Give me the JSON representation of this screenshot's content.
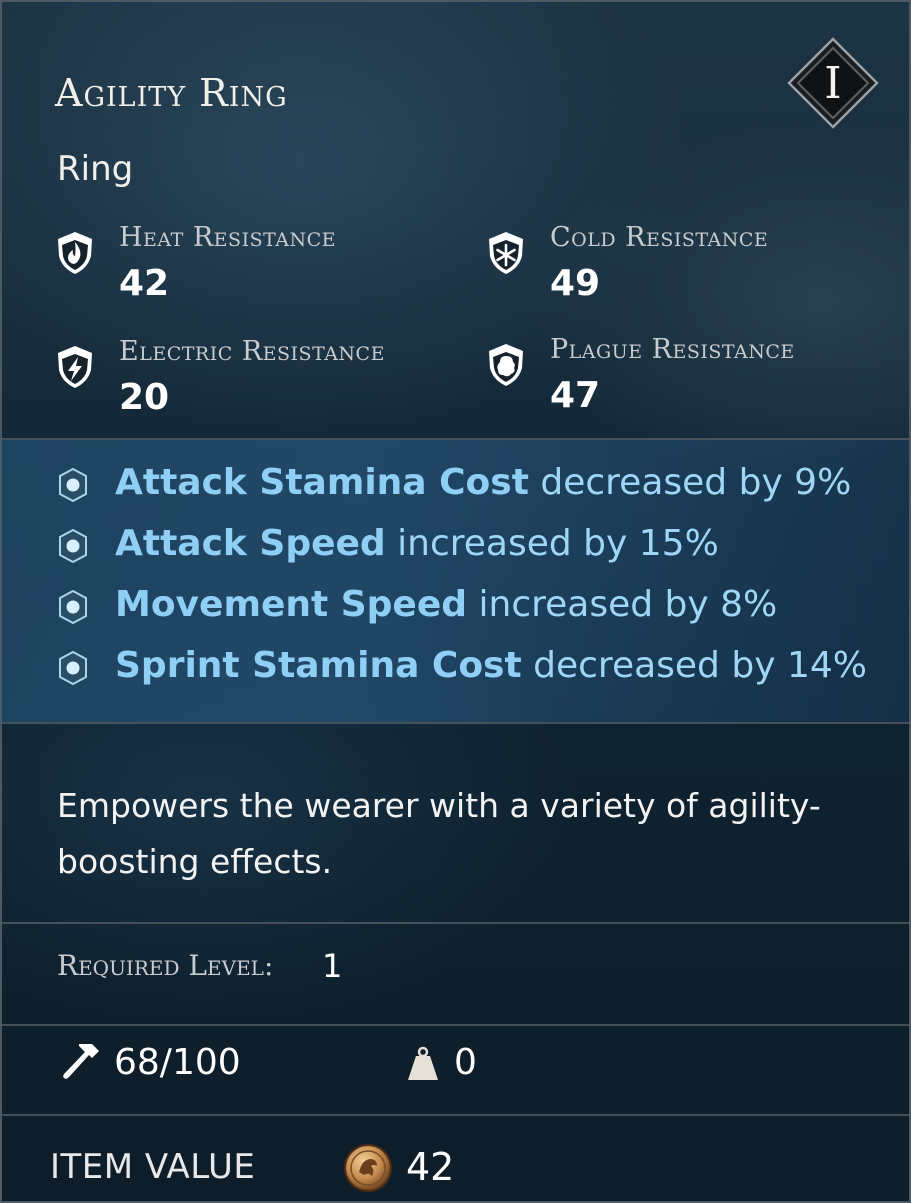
{
  "item": {
    "name": "Agility Ring",
    "type": "Ring",
    "tier": "I"
  },
  "resistances": [
    {
      "label": "Heat Resistance",
      "value": "42",
      "icon": "heat-resistance-icon"
    },
    {
      "label": "Cold Resistance",
      "value": "49",
      "icon": "cold-resistance-icon"
    },
    {
      "label": "Electric Resistance",
      "value": "20",
      "icon": "electric-resistance-icon"
    },
    {
      "label": "Plague Resistance",
      "value": "47",
      "icon": "plague-resistance-icon"
    }
  ],
  "perks": [
    {
      "name": "Attack Stamina Cost",
      "effect": "decreased by 9%"
    },
    {
      "name": "Attack Speed",
      "effect": "increased by 15%"
    },
    {
      "name": "Movement Speed",
      "effect": "increased by 8%"
    },
    {
      "name": "Sprint Stamina Cost",
      "effect": "decreased by 14%"
    }
  ],
  "description": "Empowers the wearer with a variety of agility-boosting effects.",
  "requirements": {
    "label": "Required Level:",
    "level": "1"
  },
  "durability": {
    "text": "68/100",
    "current": 68,
    "max": 100,
    "icon": "hammer-icon"
  },
  "weight": {
    "value": "0",
    "icon": "weight-icon"
  },
  "value": {
    "label": "ITEM VALUE",
    "amount": "42",
    "icon": "coin-icon"
  },
  "colors": {
    "perk_text": "#9fd6f6",
    "perk_band": "#2f6a96",
    "panel_bg": "#142a39",
    "divider": "#586066"
  }
}
